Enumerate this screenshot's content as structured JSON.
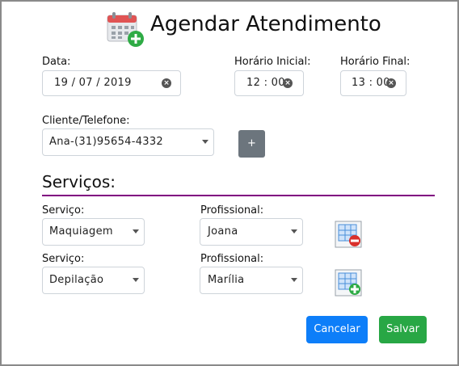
{
  "dialog": {
    "title": "Agendar Atendimento",
    "icon": "calendar-add-icon"
  },
  "schedule": {
    "date_label": "Data:",
    "date_value": "19 / 07 / 2019",
    "start_label": "Horário Inicial:",
    "start_value": "12 : 00",
    "end_label": "Horário Final:",
    "end_value": "13 : 00"
  },
  "client": {
    "label": "Cliente/Telefone:",
    "selected": "Ana-(31)95654-4332",
    "add_button_label": "+"
  },
  "services": {
    "section_title": "Serviços:",
    "rows": [
      {
        "service_label": "Serviço:",
        "service_value": "Maquiagem",
        "professional_label": "Profissional:",
        "professional_value": "Joana",
        "action_icon": "remove-row-icon"
      },
      {
        "service_label": "Serviço:",
        "service_value": "Depilação",
        "professional_label": "Profissional:",
        "professional_value": "Marília",
        "action_icon": "add-row-icon"
      }
    ]
  },
  "actions": {
    "cancel_label": "Cancelar",
    "save_label": "Salvar"
  },
  "colors": {
    "section_rule": "#800080",
    "cancel_button": "#0d7ef9",
    "save_button": "#28a745",
    "add_client_button": "#6c757d"
  }
}
